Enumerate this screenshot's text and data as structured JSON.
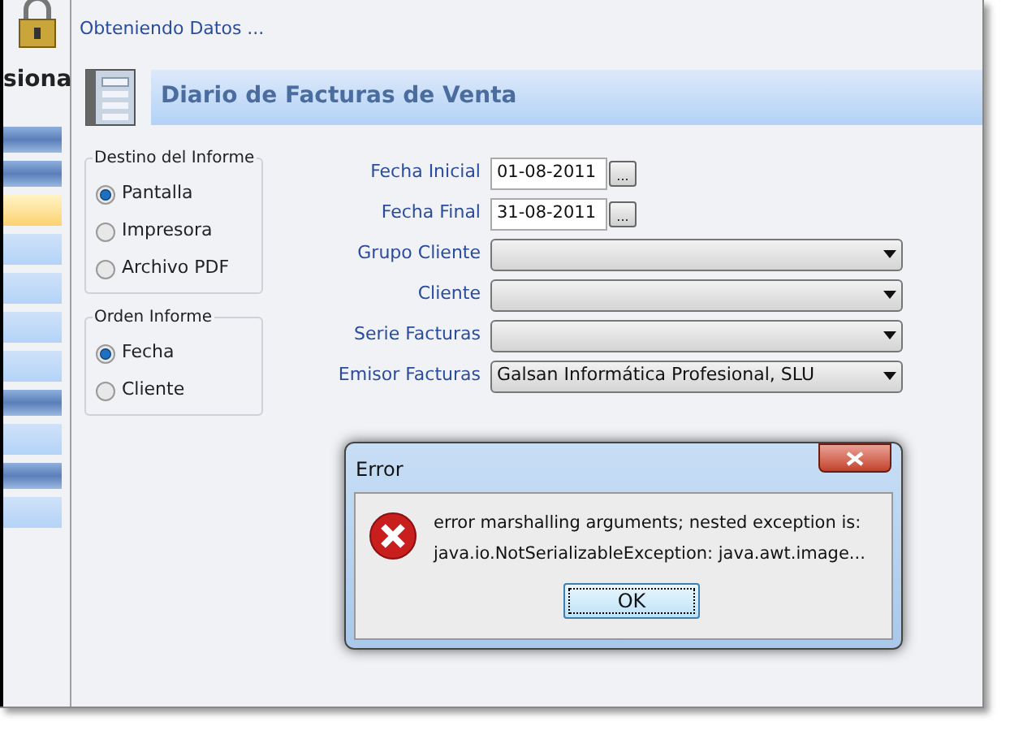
{
  "sidebar": {
    "title": "siona",
    "items": [
      {
        "kind": "header",
        "selected": false
      },
      {
        "kind": "header",
        "selected": false
      },
      {
        "kind": "item",
        "selected": true
      },
      {
        "kind": "item",
        "selected": false
      },
      {
        "kind": "item",
        "selected": false
      },
      {
        "kind": "item",
        "selected": false
      },
      {
        "kind": "item",
        "selected": false
      },
      {
        "kind": "header",
        "selected": false
      },
      {
        "kind": "item",
        "selected": false
      },
      {
        "kind": "header",
        "selected": false
      },
      {
        "kind": "item",
        "selected": false
      }
    ]
  },
  "status": "Obteniendo Datos ...",
  "header": {
    "title": "Diario de Facturas de Venta"
  },
  "groups": [
    {
      "title": "Destino del Informe",
      "options": [
        {
          "label": "Pantalla",
          "selected": true
        },
        {
          "label": "Impresora",
          "selected": false
        },
        {
          "label": "Archivo PDF",
          "selected": false
        }
      ]
    },
    {
      "title": "Orden Informe",
      "options": [
        {
          "label": "Fecha",
          "selected": true
        },
        {
          "label": "Cliente",
          "selected": false
        }
      ]
    }
  ],
  "fields": [
    {
      "kind": "date",
      "label": "Fecha Inicial",
      "value": "01-08-2011",
      "button": "..."
    },
    {
      "kind": "date",
      "label": "Fecha Final",
      "value": "31-08-2011",
      "button": "..."
    },
    {
      "kind": "select",
      "label": "Grupo Cliente"
    },
    {
      "kind": "select",
      "label": "Cliente"
    },
    {
      "kind": "select",
      "label": "Serie Facturas"
    },
    {
      "kind": "select",
      "label": "Emisor Facturas",
      "value": "Galsan Informática Profesional, SLU"
    }
  ],
  "dialog": {
    "title": "Error",
    "message": [
      "error marshalling arguments; nested exception is:",
      "java.io.NotSerializableException: java.awt.image..."
    ],
    "button": "OK"
  }
}
